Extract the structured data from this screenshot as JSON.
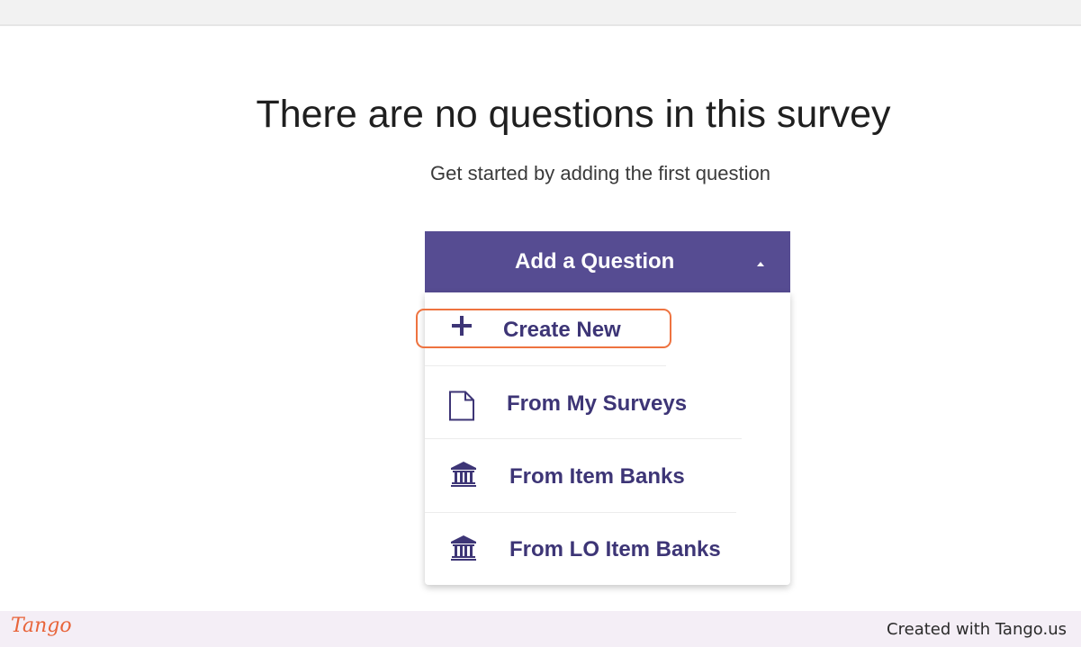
{
  "empty_state": {
    "title": "There are no questions in this survey",
    "subtitle": "Get started by adding the first question"
  },
  "add_question_button": {
    "label": "Add a Question",
    "icon": "chevron-up-icon"
  },
  "dropdown": {
    "items": [
      {
        "label": "Create New",
        "icon": "plus-icon",
        "highlighted": true
      },
      {
        "label": "From My Surveys",
        "icon": "document-icon"
      },
      {
        "label": "From Item Banks",
        "icon": "bank-icon"
      },
      {
        "label": "From LO Item Banks",
        "icon": "bank-icon"
      }
    ]
  },
  "footer": {
    "logo": "Tango",
    "credit": "Created with Tango.us"
  },
  "colors": {
    "primary": "#564c92",
    "menu_text": "#3d3576",
    "highlight": "#ee7340",
    "footer_bg": "#f4eef6"
  }
}
